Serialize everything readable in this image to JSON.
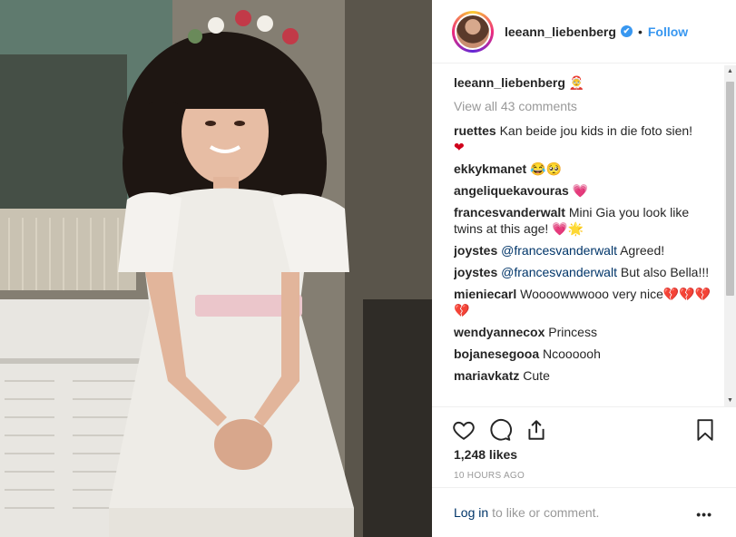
{
  "header": {
    "username": "leeann_liebenberg",
    "verified_mark": "✔",
    "separator": "•",
    "follow_label": "Follow"
  },
  "caption": {
    "username": "leeann_liebenberg",
    "emoji": "🤶"
  },
  "view_all_comments": "View all 43 comments",
  "comments": [
    {
      "user": "ruettes",
      "text": " Kan beide jou kids in die foto sien!",
      "tail": "❤"
    },
    {
      "user": "ekkykmanet",
      "text": " 😂🥺",
      "tail": ""
    },
    {
      "user": "angeliquekavouras",
      "text": " 💗",
      "tail": ""
    },
    {
      "user": "francesvanderwalt",
      "text": " Mini Gia you look like twins at this age! 💗🌟",
      "tail": ""
    },
    {
      "user": "joystes",
      "mention": "@francesvanderwalt",
      "text": " Agreed!"
    },
    {
      "user": "joystes",
      "mention": "@francesvanderwalt",
      "text": " But also Bella!!!"
    },
    {
      "user": "mieniecarl",
      "text": " Woooowwwooo very nice💔💔💔",
      "tail": "💔"
    },
    {
      "user": "wendyannecox",
      "text": " Princess",
      "tail": ""
    },
    {
      "user": "bojanesegooa",
      "text": " Ncoooooh",
      "tail": ""
    },
    {
      "user": "mariavkatz",
      "text": " Cute",
      "tail": ""
    }
  ],
  "icons": {
    "like": "heart-outline-icon",
    "comment": "comment-bubble-icon",
    "share": "share-icon",
    "save": "bookmark-icon",
    "more": "more-options-icon"
  },
  "likes": "1,248 likes",
  "timestamp": "10 HOURS AGO",
  "login_prompt": {
    "link": "Log in",
    "rest": "to like or comment.",
    "more": "•••"
  },
  "colors": {
    "link_blue": "#3897f0",
    "heart_red": "#d0021b",
    "muted": "#999999"
  }
}
